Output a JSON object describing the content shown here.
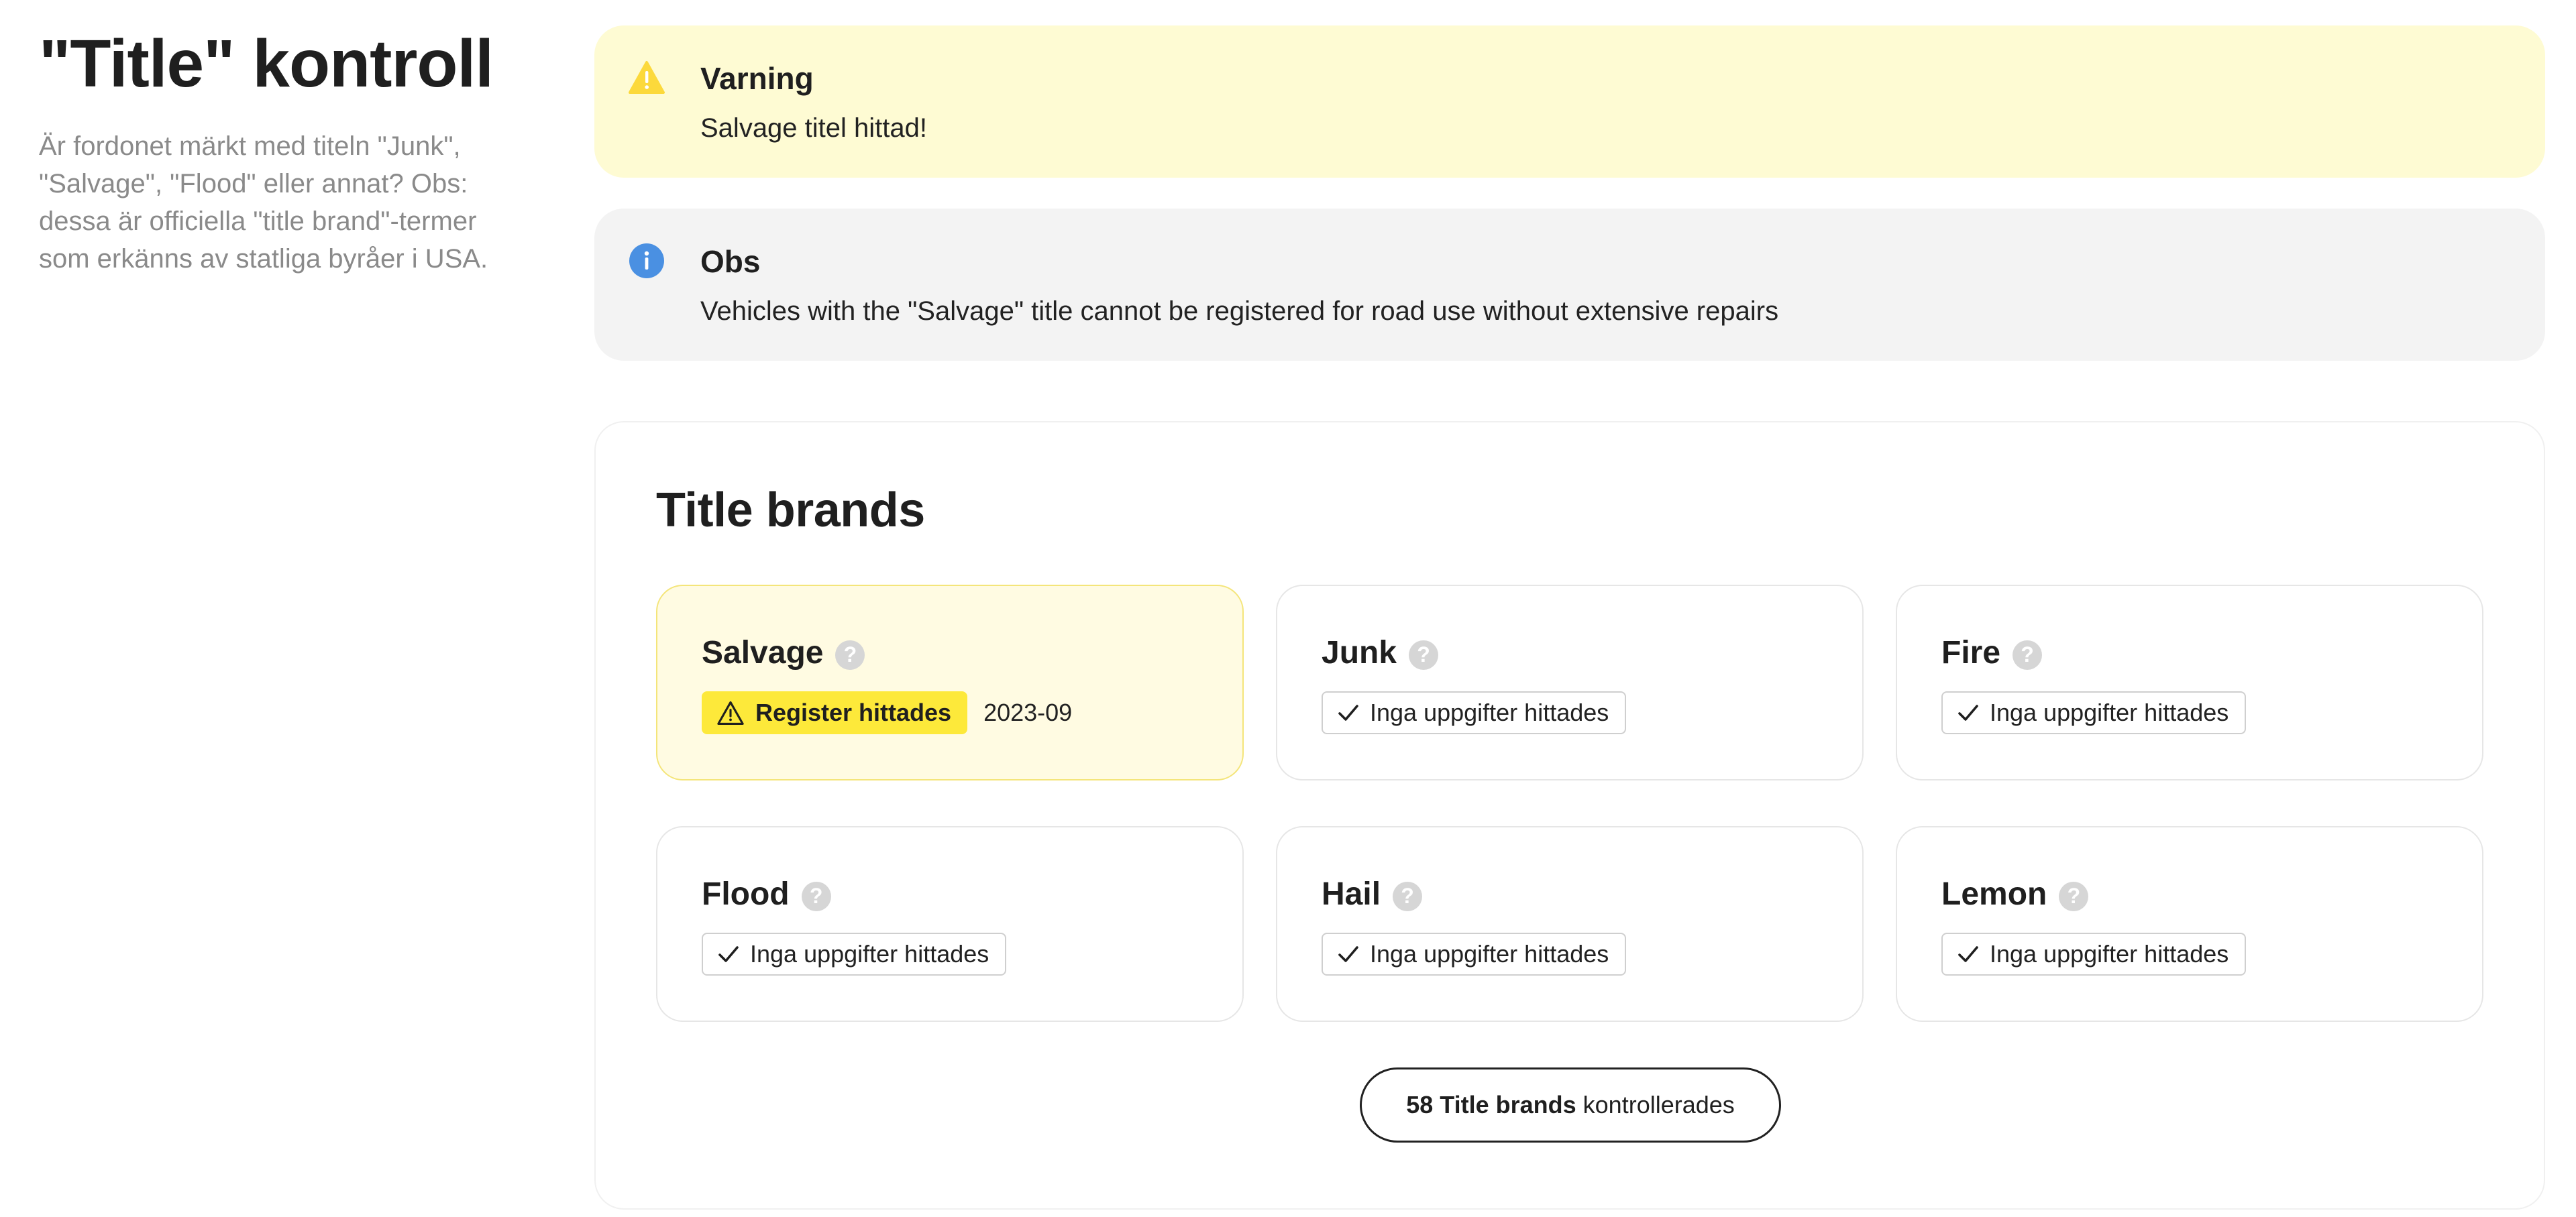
{
  "header": {
    "title": "\"Title\" kontroll",
    "description": "Är fordonet märkt med titeln \"Junk\", \"Salvage\", \"Flood\" eller annat? Obs: dessa är officiella \"title brand\"-termer som erkänns av statliga byråer i USA."
  },
  "alerts": {
    "warning": {
      "title": "Varning",
      "text": "Salvage titel hittad!",
      "icon": "warning-triangle-icon",
      "color": "#fde93a"
    },
    "info": {
      "title": "Obs",
      "text": "Vehicles with the \"Salvage\" title cannot be registered for road use without extensive repairs",
      "icon": "info-circle-icon",
      "color": "#4a90e2"
    }
  },
  "card": {
    "title": "Title brands",
    "brands": [
      {
        "name": "Salvage",
        "status": "Register hittades",
        "date": "2023-09",
        "found": true
      },
      {
        "name": "Junk",
        "status": "Inga uppgifter hittades",
        "found": false
      },
      {
        "name": "Fire",
        "status": "Inga uppgifter hittades",
        "found": false
      },
      {
        "name": "Flood",
        "status": "Inga uppgifter hittades",
        "found": false
      },
      {
        "name": "Hail",
        "status": "Inga uppgifter hittades",
        "found": false
      },
      {
        "name": "Lemon",
        "status": "Inga uppgifter hittades",
        "found": false
      }
    ],
    "help_symbol": "?",
    "checked_button": {
      "count_label": "58 Title brands",
      "suffix": "kontrollerades"
    }
  }
}
